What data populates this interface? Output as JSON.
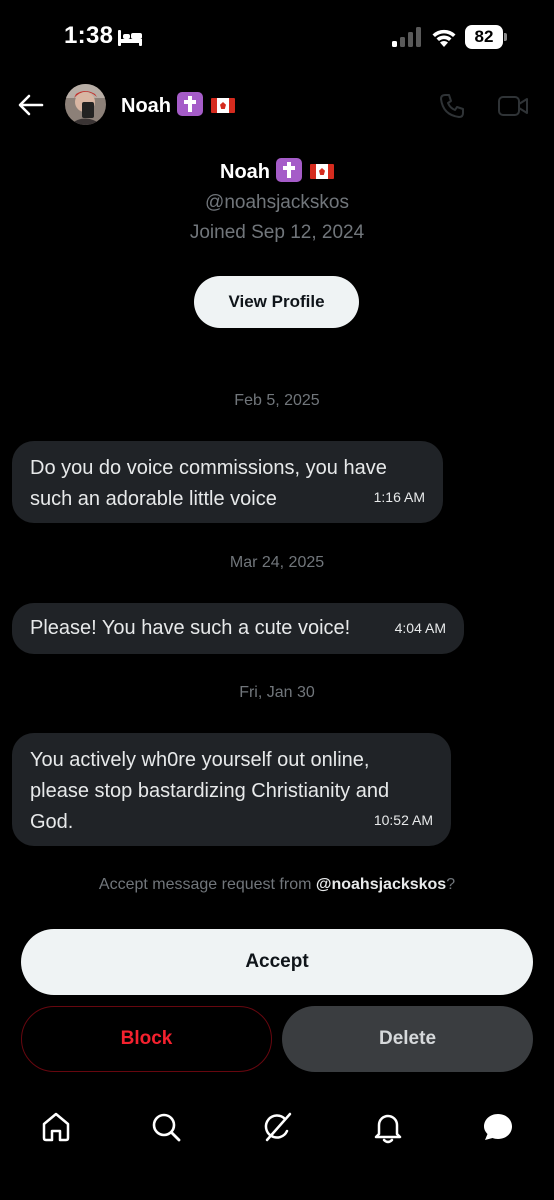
{
  "status_bar": {
    "time": "1:38",
    "battery": "82"
  },
  "header": {
    "name": "Noah"
  },
  "profile": {
    "name": "Noah",
    "handle": "@noahsjackskos",
    "joined": "Joined Sep 12, 2024",
    "view_profile_label": "View Profile"
  },
  "messages": [
    {
      "date": "Feb 5, 2025",
      "text": "Do you do voice commissions, you have such an adorable little voice",
      "time": "1:16 AM"
    },
    {
      "date": "Mar 24, 2025",
      "text": "Please! You have such a cute voice!",
      "time": "4:04 AM"
    },
    {
      "date": "Fri, Jan 30",
      "text": "You actively wh0re yourself out online, please stop bastardizing Christianity and God.",
      "time": "10:52 AM"
    }
  ],
  "request": {
    "prefix": "Accept message request from ",
    "handle": "@noahsjackskos",
    "suffix": "?",
    "accept_label": "Accept",
    "block_label": "Block",
    "delete_label": "Delete"
  },
  "nav": {
    "items": [
      "home-icon",
      "search-icon",
      "grok-icon",
      "notifications-icon",
      "messages-icon"
    ]
  },
  "colors": {
    "background": "#000000",
    "bubble": "#202327",
    "muted": "#71767b",
    "danger": "#f4212e",
    "accent_badge": "#a55cc8"
  }
}
